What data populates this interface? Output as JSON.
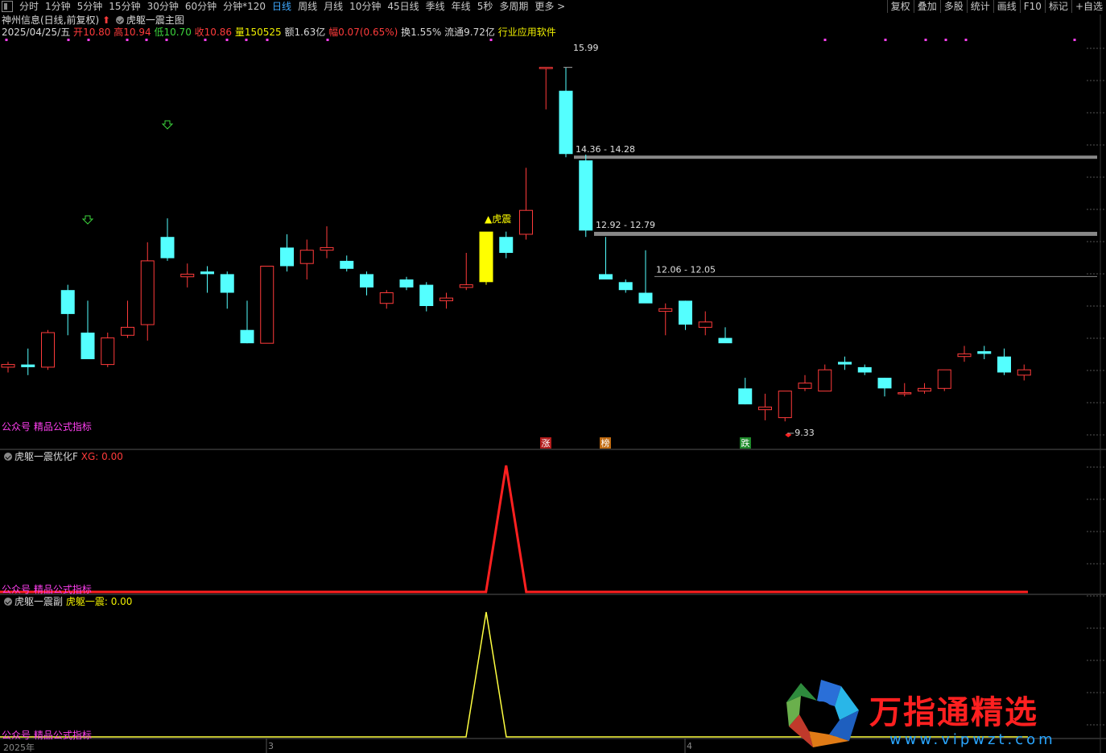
{
  "toolbar": {
    "periods": [
      "分时",
      "1分钟",
      "5分钟",
      "15分钟",
      "30分钟",
      "60分钟",
      "分钟*120",
      "日线",
      "周线",
      "月线",
      "10分钟",
      "45日线",
      "季线",
      "年线",
      "5秒",
      "多周期",
      "更多 >"
    ],
    "active_period": "日线",
    "right_buttons": [
      "复权",
      "叠加",
      "多股",
      "统计",
      "画线",
      "F10",
      "标记",
      "+自选"
    ]
  },
  "header": {
    "stock_name": "神州信息(日线,前复权)",
    "main_chart_title": "虎躯一震主图",
    "date": "2025/04/25/五",
    "open_label": "开",
    "open": "10.80",
    "high_label": "高",
    "high": "10.94",
    "low_label": "低",
    "low": "10.70",
    "close_label": "收",
    "close": "10.86",
    "volume_label": "量",
    "volume": "150525",
    "amount_label": "额",
    "amount": "1.63亿",
    "change_label": "幅",
    "change": "0.07(0.65%)",
    "turnover_label": "换",
    "turnover": "1.55%",
    "float_label": "流通",
    "float_cap": "9.72亿",
    "industry": "行业应用软件"
  },
  "main_chart": {
    "watermark": "公众号 精品公式指标",
    "signal_label": "▲虎震",
    "high_marker": "15.99",
    "low_marker": "9.33",
    "levels": [
      "14.36 - 14.28",
      "12.92 - 12.79",
      "12.06 - 12.05"
    ],
    "badges": [
      "涨",
      "榜",
      "跌"
    ],
    "colors": {
      "up": "#ff3b3b",
      "down": "#54ffff",
      "signal": "#ffff00",
      "level_line": "#888888"
    }
  },
  "chart_data": [
    {
      "type": "candlestick",
      "title": "虎躯一震主图",
      "candles": [
        {
          "o": 10.35,
          "h": 10.45,
          "l": 10.25,
          "c": 10.4
        },
        {
          "o": 10.4,
          "h": 10.7,
          "l": 10.2,
          "c": 10.35
        },
        {
          "o": 10.35,
          "h": 11.05,
          "l": 10.3,
          "c": 11.0
        },
        {
          "o": 11.8,
          "h": 11.9,
          "l": 10.95,
          "c": 11.35
        },
        {
          "o": 11.0,
          "h": 11.6,
          "l": 10.95,
          "c": 10.5
        },
        {
          "o": 10.4,
          "h": 11.0,
          "l": 10.35,
          "c": 10.9
        },
        {
          "o": 10.95,
          "h": 11.6,
          "l": 10.9,
          "c": 11.1
        },
        {
          "o": 11.15,
          "h": 12.7,
          "l": 10.85,
          "c": 12.35
        },
        {
          "o": 12.8,
          "h": 13.15,
          "l": 12.35,
          "c": 12.4
        },
        {
          "o": 12.05,
          "h": 12.3,
          "l": 11.85,
          "c": 12.1
        },
        {
          "o": 12.15,
          "h": 12.25,
          "l": 11.75,
          "c": 12.1
        },
        {
          "o": 12.1,
          "h": 12.15,
          "l": 11.45,
          "c": 11.75
        },
        {
          "o": 11.05,
          "h": 11.6,
          "l": 10.8,
          "c": 10.8
        },
        {
          "o": 10.8,
          "h": 12.2,
          "l": 10.9,
          "c": 12.25
        },
        {
          "o": 12.6,
          "h": 12.85,
          "l": 12.15,
          "c": 12.25
        },
        {
          "o": 12.3,
          "h": 12.75,
          "l": 12.0,
          "c": 12.55
        },
        {
          "o": 12.55,
          "h": 13.0,
          "l": 12.4,
          "c": 12.6
        },
        {
          "o": 12.35,
          "h": 12.45,
          "l": 12.15,
          "c": 12.2
        },
        {
          "o": 12.1,
          "h": 12.15,
          "l": 11.7,
          "c": 11.85
        },
        {
          "o": 11.55,
          "h": 11.8,
          "l": 11.45,
          "c": 11.75
        },
        {
          "o": 12.0,
          "h": 12.05,
          "l": 11.8,
          "c": 11.85
        },
        {
          "o": 11.9,
          "h": 11.95,
          "l": 11.4,
          "c": 11.5
        },
        {
          "o": 11.6,
          "h": 11.75,
          "l": 11.45,
          "c": 11.65
        },
        {
          "o": 11.85,
          "h": 12.5,
          "l": 11.8,
          "c": 11.9
        },
        {
          "o": 11.95,
          "h": 12.85,
          "l": 11.9,
          "c": 12.9
        },
        {
          "o": 12.8,
          "h": 12.9,
          "l": 12.4,
          "c": 12.5
        },
        {
          "o": 12.85,
          "h": 14.1,
          "l": 12.75,
          "c": 13.3
        },
        {
          "o": 15.99,
          "h": 15.99,
          "l": 15.2,
          "c": 15.99
        },
        {
          "o": 15.55,
          "h": 15.99,
          "l": 14.3,
          "c": 14.36
        },
        {
          "o": 14.24,
          "h": 14.35,
          "l": 12.8,
          "c": 12.92
        },
        {
          "o": 12.1,
          "h": 12.8,
          "l": 12.05,
          "c": 12.0
        },
        {
          "o": 11.95,
          "h": 12.0,
          "l": 11.75,
          "c": 11.8
        },
        {
          "o": 11.75,
          "h": 12.55,
          "l": 11.6,
          "c": 11.55
        },
        {
          "o": 11.4,
          "h": 11.55,
          "l": 10.95,
          "c": 11.45
        },
        {
          "o": 11.6,
          "h": 11.6,
          "l": 11.05,
          "c": 11.15
        },
        {
          "o": 11.1,
          "h": 11.4,
          "l": 10.95,
          "c": 11.2
        },
        {
          "o": 10.9,
          "h": 11.1,
          "l": 10.85,
          "c": 10.8
        },
        {
          "o": 9.95,
          "h": 10.15,
          "l": 9.65,
          "c": 9.65
        },
        {
          "o": 9.55,
          "h": 9.85,
          "l": 9.35,
          "c": 9.6
        },
        {
          "o": 9.4,
          "h": 9.8,
          "l": 9.33,
          "c": 9.9
        },
        {
          "o": 9.95,
          "h": 10.2,
          "l": 9.9,
          "c": 10.05
        },
        {
          "o": 9.9,
          "h": 10.4,
          "l": 9.9,
          "c": 10.3
        },
        {
          "o": 10.45,
          "h": 10.55,
          "l": 10.3,
          "c": 10.4
        },
        {
          "o": 10.35,
          "h": 10.4,
          "l": 10.2,
          "c": 10.25
        },
        {
          "o": 10.15,
          "h": 10.15,
          "l": 9.8,
          "c": 9.95
        },
        {
          "o": 9.85,
          "h": 10.05,
          "l": 9.8,
          "c": 9.87
        },
        {
          "o": 9.9,
          "h": 10.05,
          "l": 9.85,
          "c": 9.95
        },
        {
          "o": 9.95,
          "h": 10.3,
          "l": 9.9,
          "c": 10.3
        },
        {
          "o": 10.55,
          "h": 10.75,
          "l": 10.45,
          "c": 10.6
        },
        {
          "o": 10.65,
          "h": 10.75,
          "l": 10.5,
          "c": 10.6
        },
        {
          "o": 10.55,
          "h": 10.7,
          "l": 10.2,
          "c": 10.25
        },
        {
          "o": 10.2,
          "h": 10.4,
          "l": 10.1,
          "c": 10.3
        }
      ],
      "signal_index": 24,
      "ylim": [
        9.0,
        16.5
      ]
    },
    {
      "type": "line",
      "title": "虎躯一震优化F",
      "series": [
        {
          "name": "XG",
          "color": "#ff2020",
          "peak_index": 25,
          "value_now": "0.00"
        }
      ],
      "ylim": [
        0,
        1
      ]
    },
    {
      "type": "line",
      "title": "虎躯一震副",
      "series": [
        {
          "name": "虎躯一震",
          "color": "#ffff40",
          "peak_index": 24,
          "value_now": "0.00"
        }
      ],
      "ylim": [
        0,
        1
      ]
    }
  ],
  "sub1": {
    "title": "虎躯一震优化F",
    "xg_label": "XG:",
    "xg_value": "0.00",
    "watermark": "公众号 精品公式指标"
  },
  "sub2": {
    "title": "虎躯一震副",
    "ind_label": "虎躯一震:",
    "ind_value": "0.00",
    "watermark": "公众号 精品公式指标"
  },
  "xaxis": {
    "labels": [
      "2025年",
      "3",
      "4"
    ]
  },
  "brand": {
    "name": "万指通精选",
    "url": "www.vipwzt.com"
  }
}
